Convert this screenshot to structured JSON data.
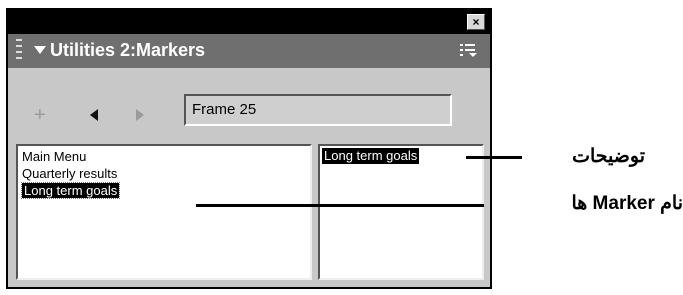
{
  "panel": {
    "title": "Utilities 2:Markers",
    "close_icon": "close-icon",
    "options_icon": "options-menu-icon"
  },
  "toolbar": {
    "add_icon": "plus-icon",
    "prev_icon": "triangle-left-icon",
    "next_icon": "triangle-right-icon",
    "frame_field_value": "Frame 25"
  },
  "markers_list": {
    "items": [
      "Main Menu",
      "Quarterly results",
      "Long term goals"
    ],
    "selected_index": 2
  },
  "description": {
    "text": "Long term goals"
  },
  "annotations": {
    "description_label": "توضیحات",
    "marker_name_label": "نام Marker ها"
  }
}
